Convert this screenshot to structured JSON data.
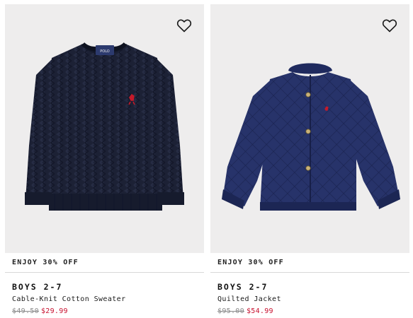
{
  "products": [
    {
      "promo": "ENJOY 30% OFF",
      "category": "BOYS 2-7",
      "name": "Cable-Knit Cotton Sweater",
      "original_price": "$49.50",
      "sale_price": "$29.99",
      "image": "navy-cable-knit-sweater",
      "color": "#1c2135"
    },
    {
      "promo": "ENJOY 30% OFF",
      "category": "BOYS 2-7",
      "name": "Quilted Jacket",
      "original_price": "$95.00",
      "sale_price": "$54.99",
      "image": "navy-quilted-jacket",
      "color": "#273268"
    }
  ],
  "colors": {
    "image_background": "#eeeded",
    "sale": "#c8102e",
    "strike": "#8a8a8a"
  },
  "icons": {
    "wishlist": "heart-outline-icon"
  }
}
